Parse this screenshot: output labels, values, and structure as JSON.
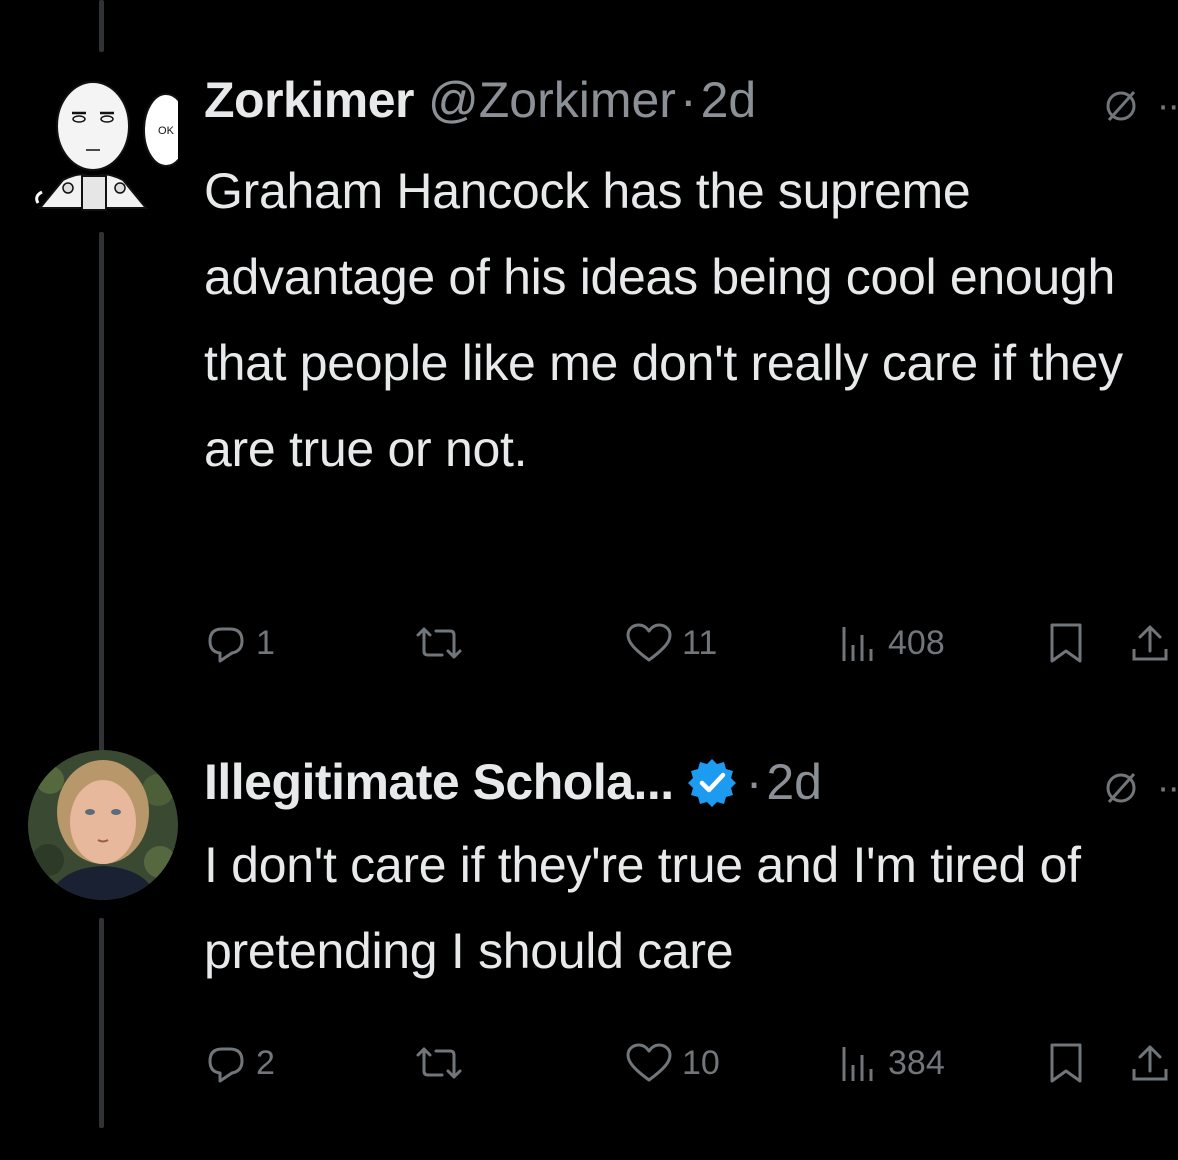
{
  "tweets": [
    {
      "display_name": "Zorkimer",
      "handle": "@Zorkimer",
      "separator": "·",
      "time": "2d",
      "verified": false,
      "avatar_icon": "bald-hero-manga-icon",
      "avatar_bubble_text": "OK",
      "text": "Graham Hancock has the supreme advantage of his ideas being cool enough that people like me don't really care if they are true or not.",
      "replies": "1",
      "retweets": "",
      "likes": "11",
      "views": "408"
    },
    {
      "display_name": "Illegitimate Schola...",
      "handle": "",
      "separator": "·",
      "time": "2d",
      "verified": true,
      "avatar_icon": "man-portrait-icon",
      "text": "I don't care if they're true and I'm tired of pretending I should care",
      "replies": "2",
      "retweets": "",
      "likes": "10",
      "views": "384"
    }
  ],
  "colors": {
    "background": "#000000",
    "primary_text": "#e7e9ea",
    "secondary_text": "#8b9096",
    "icon": "#71767b",
    "verified": "#1d9bf0",
    "thread_line": "#2f3336"
  }
}
